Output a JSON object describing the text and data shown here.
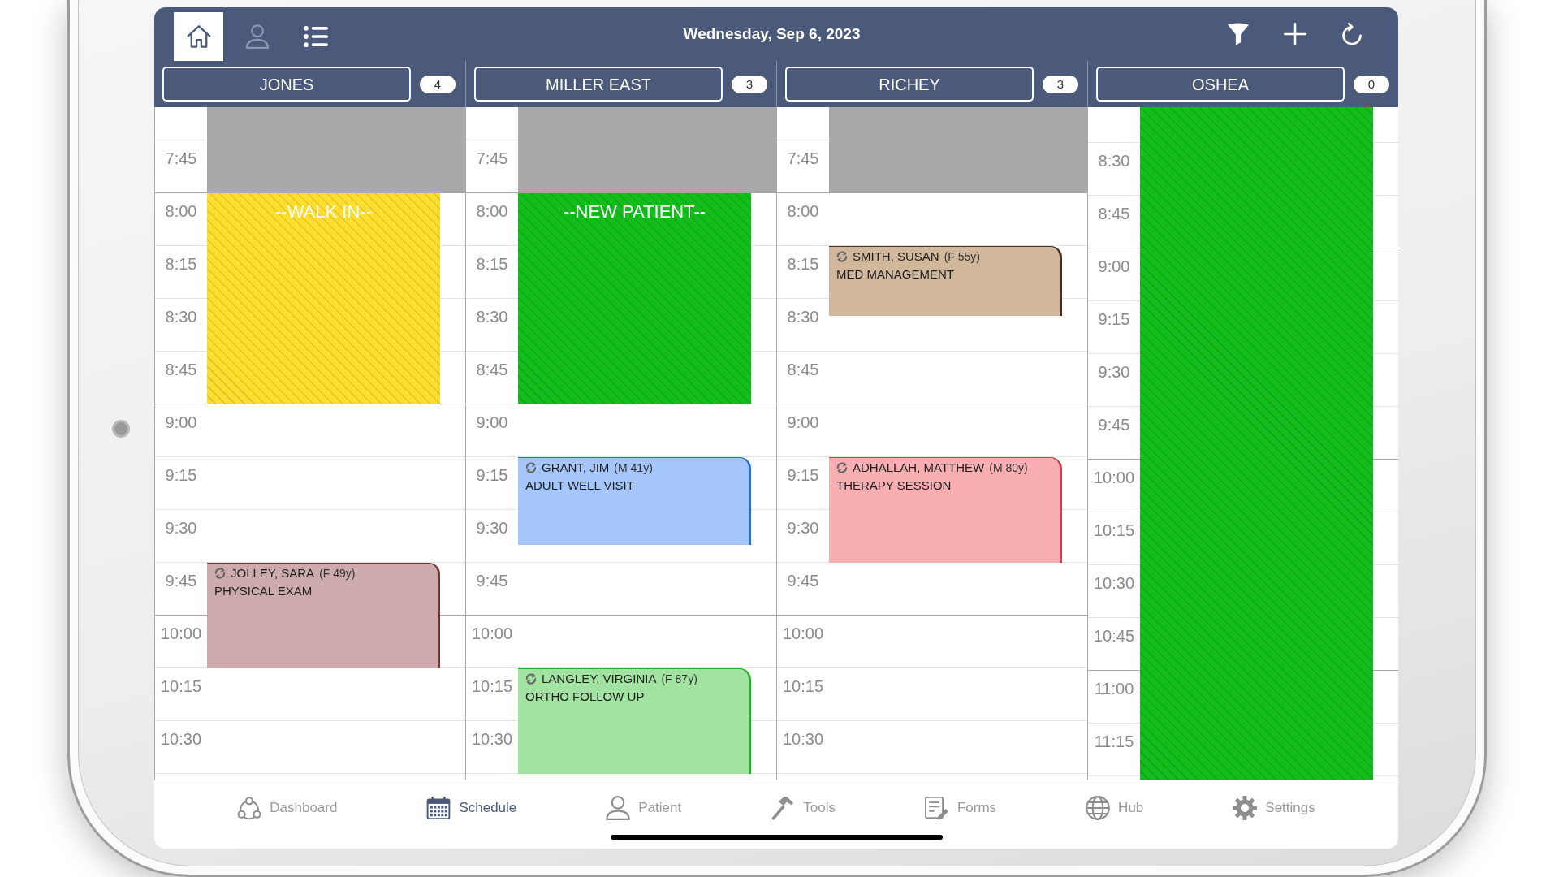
{
  "header": {
    "toolbar": [
      {
        "kind": "home",
        "selected": true,
        "disabled": false
      },
      {
        "kind": "person",
        "selected": false,
        "disabled": true
      },
      {
        "kind": "list",
        "selected": false,
        "disabled": false
      }
    ],
    "date": "Wednesday, Sep 6, 2023",
    "actions": [
      {
        "kind": "filter"
      },
      {
        "kind": "add"
      },
      {
        "kind": "refresh"
      }
    ]
  },
  "providers": [
    {
      "name": "JONES",
      "count": "4",
      "time_slots": [
        "7:45",
        "8:00",
        "8:15",
        "8:30",
        "8:45",
        "9:00",
        "9:15",
        "9:30",
        "9:45",
        "10:00",
        "10:15",
        "10:30"
      ],
      "entries": [
        {
          "kind": "unavailable"
        },
        {
          "kind": "block",
          "label": "--WALK IN--",
          "color": "#fddd2e"
        },
        {
          "kind": "appointment",
          "patient": "JOLLEY, SARA",
          "demographics": "(F 49y)",
          "reason": "PHYSICAL EXAM",
          "color": "#cdaaac",
          "border": {
            "color": "#6f3833"
          }
        }
      ]
    },
    {
      "name": "MILLER EAST",
      "count": "3",
      "time_slots": [
        "7:45",
        "8:00",
        "8:15",
        "8:30",
        "8:45",
        "9:00",
        "9:15",
        "9:30",
        "9:45",
        "10:00",
        "10:15",
        "10:30"
      ],
      "entries": [
        {
          "kind": "unavailable"
        },
        {
          "kind": "block",
          "label": "--NEW PATIENT--",
          "color": "#12bd1c"
        },
        {
          "kind": "appointment",
          "patient": "GRANT, JIM",
          "demographics": "(M 41y)",
          "reason": "ADULT WELL VISIT",
          "color": "#a5c6fa",
          "border": {
            "color": "#1f6fe3"
          }
        },
        {
          "kind": "appointment",
          "patient": "LANGLEY, VIRGINIA",
          "demographics": "(F 87y)",
          "reason": "ORTHO FOLLOW UP",
          "color": "#a2e3a2",
          "border": {
            "color": "#20b520"
          }
        }
      ]
    },
    {
      "name": "RICHEY",
      "count": "3",
      "time_slots": [
        "7:45",
        "8:00",
        "8:15",
        "8:30",
        "8:45",
        "9:00",
        "9:15",
        "9:30",
        "9:45",
        "10:00",
        "10:15",
        "10:30"
      ],
      "entries": [
        {
          "kind": "unavailable"
        },
        {
          "kind": "appointment",
          "patient": "SMITH, SUSAN",
          "demographics": "(F 55y)",
          "reason": "MED MANAGEMENT",
          "color": "#d1b89c",
          "border": {
            "color": "#4b2d1d"
          }
        },
        {
          "kind": "appointment",
          "patient": "ADHALLAH, MATTHEW",
          "demographics": "(M 80y)",
          "reason": "THERAPY SESSION",
          "color": "#f9aeb2",
          "border": {
            "color": "#c9434c"
          }
        }
      ]
    },
    {
      "name": "OSHEA",
      "count": "0",
      "time_slots": [
        "8:30",
        "8:45",
        "9:00",
        "9:15",
        "9:30",
        "9:45",
        "10:00",
        "10:15",
        "10:30",
        "10:45",
        "11:00",
        "11:15"
      ],
      "entries": [
        {
          "kind": "block",
          "color": "#12bd1c"
        }
      ]
    }
  ],
  "tab_bar": [
    {
      "label": "Dashboard",
      "selected": false
    },
    {
      "label": "Schedule",
      "selected": true
    },
    {
      "label": "Patient",
      "selected": false
    },
    {
      "label": "Tools",
      "selected": false
    },
    {
      "label": "Forms",
      "selected": false
    },
    {
      "label": "Hub",
      "selected": false
    },
    {
      "label": "Settings",
      "selected": false
    }
  ]
}
